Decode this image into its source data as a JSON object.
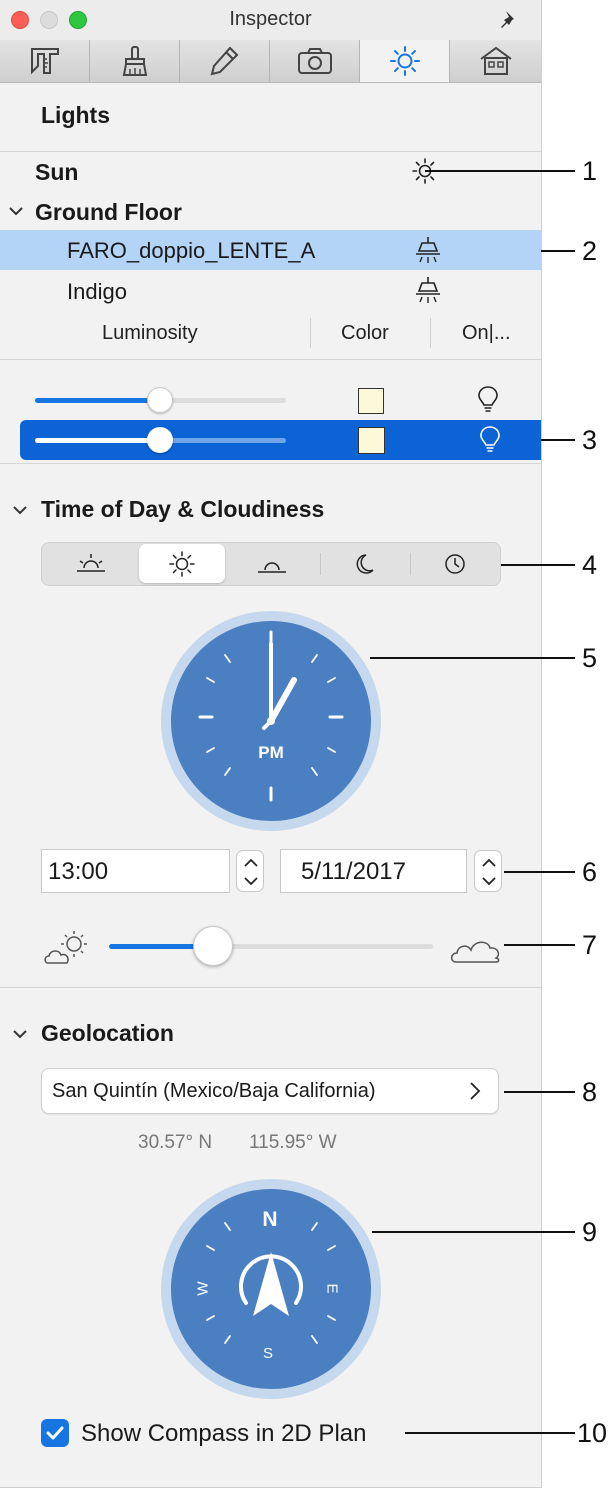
{
  "window": {
    "title": "Inspector"
  },
  "tabs": [
    {
      "icon": "ruler-caliper-icon"
    },
    {
      "icon": "brush-icon"
    },
    {
      "icon": "pencil-icon"
    },
    {
      "icon": "camera-icon"
    },
    {
      "icon": "sun-icon",
      "active": true
    },
    {
      "icon": "house-icon"
    }
  ],
  "lights": {
    "heading": "Lights",
    "items": [
      {
        "label": "Sun",
        "icon": "sun-icon"
      },
      {
        "label": "Ground Floor",
        "icon": ""
      },
      {
        "label": "FARO_doppio_LENTE_A",
        "icon": "lamp-icon",
        "selected": true
      },
      {
        "label": "Indigo",
        "icon": "lamp-icon"
      }
    ],
    "columns": [
      "Luminosity",
      "Color",
      "On|..."
    ],
    "rows": [
      {
        "luminosity": 0.49,
        "color": "#fbf9d7",
        "on": true
      },
      {
        "luminosity": 0.49,
        "color": "#fbf9d7",
        "on": true,
        "selected": true
      }
    ]
  },
  "time_of_day": {
    "heading": "Time of Day & Cloudiness",
    "segments": [
      "sunrise-icon",
      "sun-icon",
      "sunset-icon",
      "moon-icon",
      "clock-icon"
    ],
    "selected_segment": 1,
    "clock_label": "PM",
    "time": "13:00",
    "date": "5/11/2017",
    "cloudiness": 0.32
  },
  "geolocation": {
    "heading": "Geolocation",
    "location": "San Quintín (Mexico/Baja California)",
    "latitude": "30.57° N",
    "longitude": "115.95° W",
    "compass": {
      "n": "N",
      "e": "E",
      "s": "S",
      "w": "W"
    }
  },
  "show_compass": {
    "label": "Show Compass in 2D Plan",
    "checked": true
  },
  "callouts": [
    "1",
    "2",
    "3",
    "4",
    "5",
    "6",
    "7",
    "8",
    "9",
    "10"
  ],
  "colors": {
    "accent": "#1675e0",
    "selection": "#b3d3f7",
    "clock": "#4a7fc1",
    "clock_ring": "#c6d8ee"
  }
}
